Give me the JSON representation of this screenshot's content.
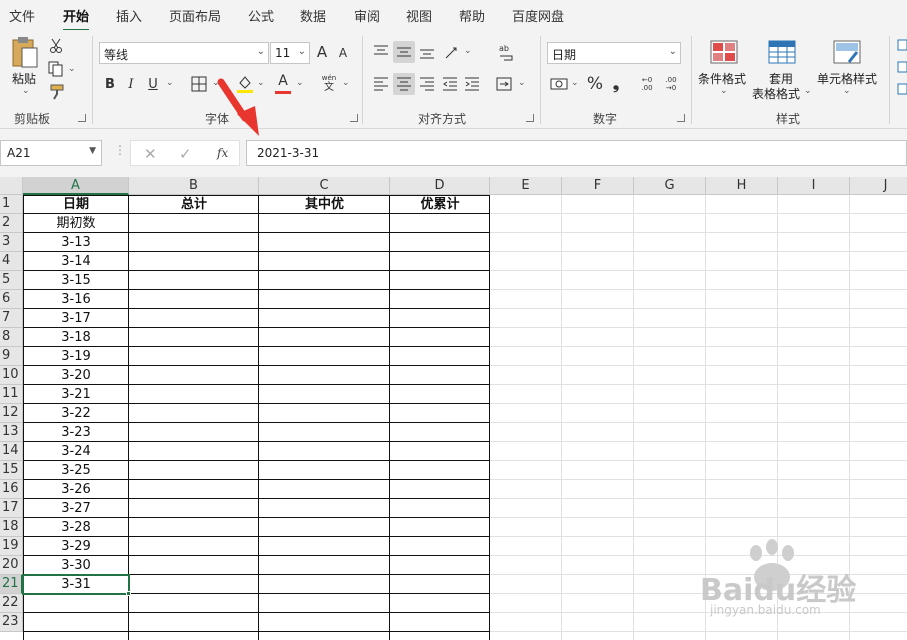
{
  "menu": {
    "tabs": [
      "文件",
      "开始",
      "插入",
      "页面布局",
      "公式",
      "数据",
      "审阅",
      "视图",
      "帮助",
      "百度网盘"
    ],
    "active_tab": "开始"
  },
  "ribbon": {
    "clipboard": {
      "paste_label": "粘贴",
      "group_label": "剪贴板"
    },
    "font": {
      "font_name": "等线",
      "font_size": "11",
      "bold": "B",
      "italic": "I",
      "underline": "U",
      "grow": "A",
      "shrink": "A",
      "font_color": "A",
      "phonetic_top": "wén",
      "phonetic_bottom": "文",
      "group_label": "字体"
    },
    "alignment": {
      "group_label": "对齐方式"
    },
    "number": {
      "format": "日期",
      "percent": "%",
      "comma": "❟",
      "dec_inc": "←0 .00",
      "dec_dec": ".00 →0",
      "group_label": "数字"
    },
    "styles": {
      "conditional_label": "条件格式",
      "table_label_1": "套用",
      "table_label_2": "表格格式",
      "cell_styles_label": "单元格样式",
      "group_label": "样式"
    }
  },
  "formula_bar": {
    "name_box": "A21",
    "fx": "fx",
    "value": "2021-3-31"
  },
  "sheet": {
    "columns": [
      "A",
      "B",
      "C",
      "D",
      "E",
      "F",
      "G",
      "H",
      "I",
      "J"
    ],
    "rows": [
      "1",
      "2",
      "3",
      "4",
      "5",
      "6",
      "7",
      "8",
      "9",
      "10",
      "11",
      "12",
      "13",
      "14",
      "15",
      "16",
      "17",
      "18",
      "19",
      "20",
      "21",
      "22",
      "23"
    ],
    "headers": [
      "日期",
      "总计",
      "其中优",
      "优累计"
    ],
    "dates": [
      "期初数",
      "3-13",
      "3-14",
      "3-15",
      "3-16",
      "3-17",
      "3-18",
      "3-19",
      "3-20",
      "3-21",
      "3-22",
      "3-23",
      "3-24",
      "3-25",
      "3-26",
      "3-27",
      "3-28",
      "3-29",
      "3-30",
      "3-31"
    ],
    "active_cell": "A21",
    "accent_color": "#217346",
    "arrow_color": "#e8352e"
  },
  "watermark": {
    "brand": "Baidu经验",
    "url": "jingyan.baidu.com"
  }
}
